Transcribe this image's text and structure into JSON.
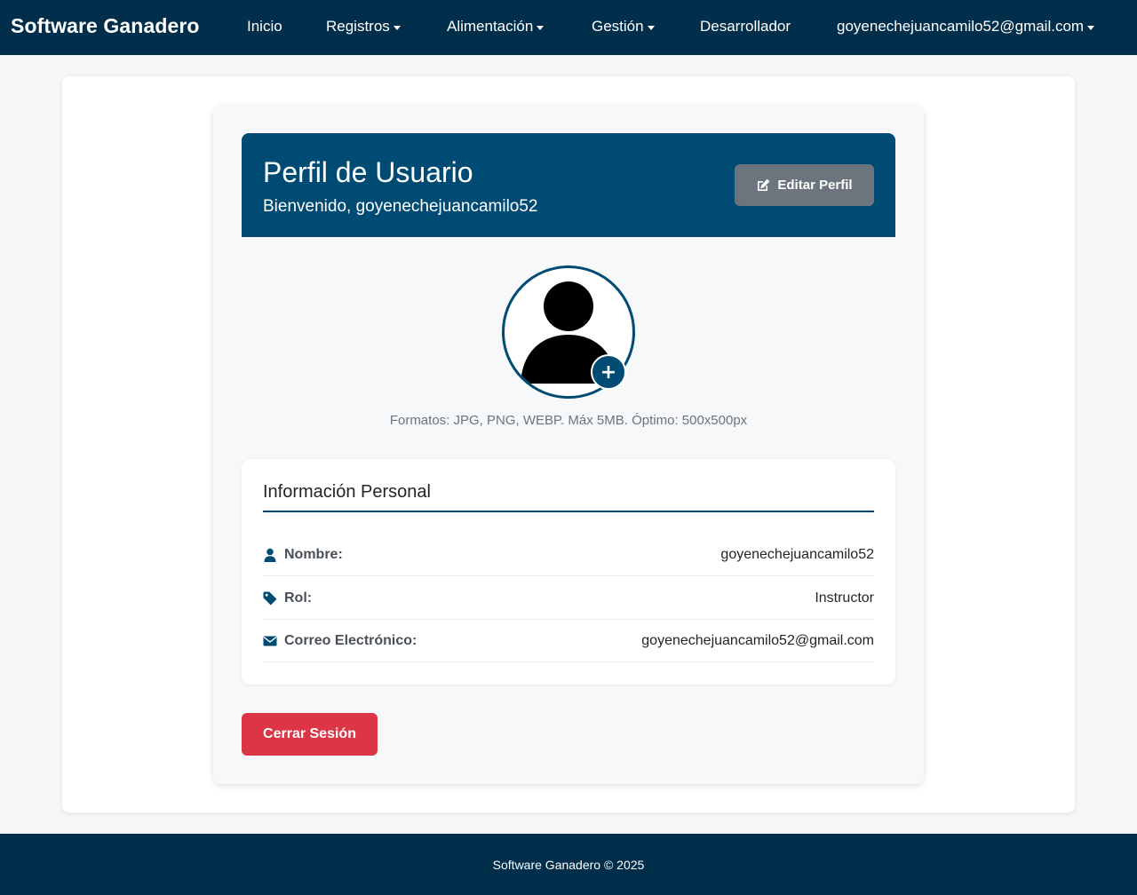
{
  "navbar": {
    "brand": "Software Ganadero",
    "items": [
      {
        "label": "Inicio",
        "dropdown": false
      },
      {
        "label": "Registros",
        "dropdown": true
      },
      {
        "label": "Alimentación",
        "dropdown": true
      },
      {
        "label": "Gestión",
        "dropdown": true
      },
      {
        "label": "Desarrollador",
        "dropdown": false
      }
    ],
    "user_menu": "goyenechejuancamilo52@gmail.com"
  },
  "profile": {
    "title": "Perfil de Usuario",
    "welcome": "Bienvenido, goyenechejuancamilo52",
    "edit_button": "Editar Perfil",
    "avatar_add": "+",
    "formats_hint": "Formatos: JPG, PNG, WEBP. Máx 5MB. Óptimo: 500x500px"
  },
  "info": {
    "title": "Información Personal",
    "rows": [
      {
        "icon": "user-icon",
        "label": "Nombre:",
        "value": "goyenechejuancamilo52"
      },
      {
        "icon": "tag-icon",
        "label": "Rol:",
        "value": "Instructor"
      },
      {
        "icon": "envelope-icon",
        "label": "Correo Electrónico:",
        "value": "goyenechejuancamilo52@gmail.com"
      }
    ]
  },
  "logout_button": "Cerrar Sesión",
  "footer": "Software Ganadero © 2025",
  "colors": {
    "navbar": "#002e4b",
    "primary": "#004b73",
    "secondary_button": "#6c757d",
    "danger": "#dc3545"
  }
}
